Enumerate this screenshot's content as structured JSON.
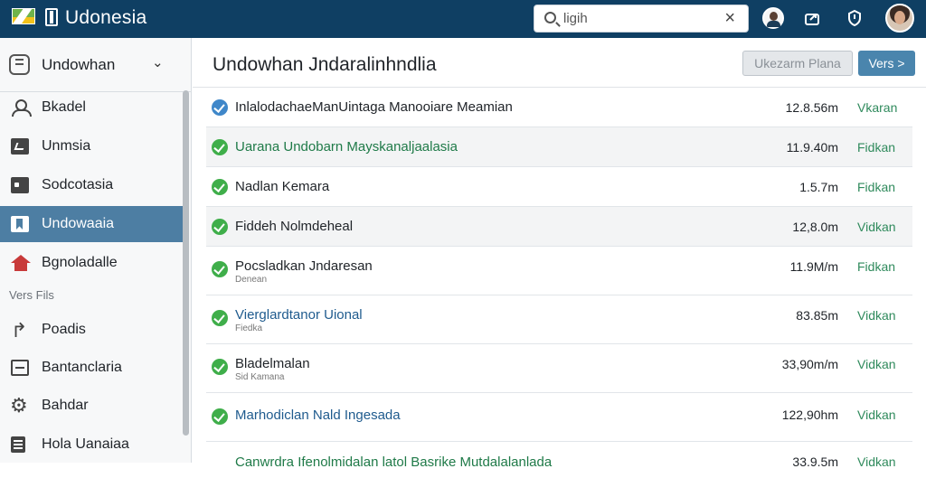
{
  "topbar": {
    "brand": "Udonesia",
    "search_value": "ligih",
    "clear_icon": "close-icon"
  },
  "sidebar": {
    "header": "Undowhan",
    "section_label": "Vers Fils",
    "items": [
      {
        "label": "Bkadel",
        "icon": "person-icon"
      },
      {
        "label": "Unmsia",
        "icon": "chart-icon"
      },
      {
        "label": "Sodcotasia",
        "icon": "card-icon"
      },
      {
        "label": "Undowaaia",
        "icon": "bookmark-icon",
        "active": true
      },
      {
        "label": "Bgnoladalle",
        "icon": "home-icon"
      },
      {
        "label": "Poadis",
        "icon": "reply-icon"
      },
      {
        "label": "Bantanclaria",
        "icon": "minus-box-icon"
      },
      {
        "label": "Bahdar",
        "icon": "gear-icon"
      },
      {
        "label": "Hola Uanaiaa",
        "icon": "document-icon"
      }
    ]
  },
  "main": {
    "title": "Undowhan Jndaralinhndlia",
    "btn_secondary": "Ukezarm Plana",
    "btn_primary": "Vers >",
    "rows": [
      {
        "name": "InlalodachaeManUintaga Manooiare Meamian",
        "sub": "",
        "size": "12.8.56m",
        "action": "Vkaran"
      },
      {
        "name": "Uarana Undobarn Mayskanaljaalasia",
        "sub": "",
        "size": "11.9.40m",
        "action": "Fidkan"
      },
      {
        "name": "Nadlan Kemara",
        "sub": "",
        "size": "1.5.7m",
        "action": "Fidkan"
      },
      {
        "name": "Fiddeh Nolmdeheal",
        "sub": "",
        "size": "12,8.0m",
        "action": "Vidkan"
      },
      {
        "name": "Pocsladkan Jndaresan",
        "sub": "Denean",
        "size": "11.9M/m",
        "action": "Fidkan"
      },
      {
        "name": "Vierglardtanor Uional",
        "sub": "Fiedka",
        "size": "83.85m",
        "action": "Vidkan"
      },
      {
        "name": "Bladelmalan",
        "sub": "Sid Kamana",
        "size": "33,90m/m",
        "action": "Vidkan"
      },
      {
        "name": "Marhodiclan Nald Ingesada",
        "sub": "",
        "size": "122,90hm",
        "action": "Vidkan"
      },
      {
        "name": "Canwrdra Ifenolmidalan latol Basrike Mutdalalanlada",
        "sub": "",
        "size": "33.9.5m",
        "action": "Vidkan"
      }
    ]
  }
}
